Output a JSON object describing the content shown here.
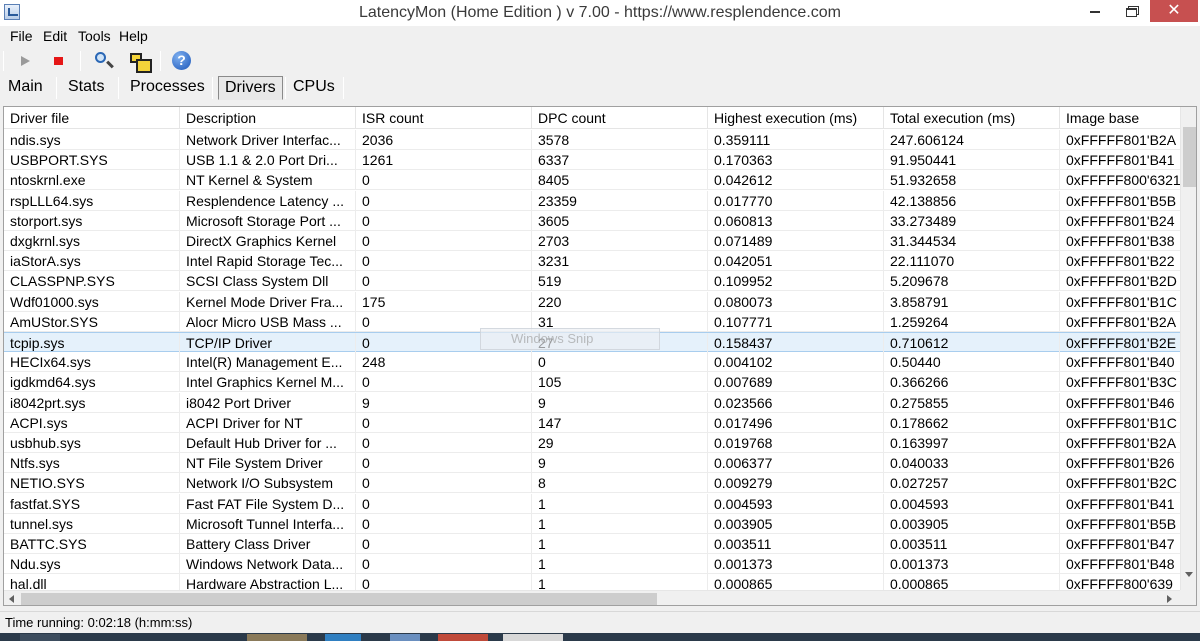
{
  "window": {
    "title": "LatencyMon  (Home Edition )  v 7.00 - https://www.resplendence.com",
    "min_label": "",
    "max_label": "",
    "close_label": "✕"
  },
  "menu": {
    "file": "File",
    "edit": "Edit",
    "tools": "Tools",
    "help": "Help"
  },
  "toolbar": {
    "icons": [
      "play-icon",
      "stop-icon",
      "search-icon",
      "windows-icon",
      "help-icon"
    ],
    "help_glyph": "?"
  },
  "tabs": [
    {
      "label": "Main"
    },
    {
      "label": "Stats"
    },
    {
      "label": "Processes"
    },
    {
      "label": "Drivers",
      "active": true
    },
    {
      "label": "CPUs"
    }
  ],
  "grid": {
    "columns": [
      "Driver file",
      "Description",
      "ISR count",
      "DPC count",
      "Highest execution (ms)",
      "Total execution (ms)",
      "Image base"
    ],
    "rows": [
      [
        "ndis.sys",
        "Network Driver Interfac...",
        "2036",
        "3578",
        "0.359111",
        "247.606124",
        "0xFFFFF801'B2A"
      ],
      [
        "USBPORT.SYS",
        "USB 1.1 & 2.0 Port Dri...",
        "1261",
        "6337",
        "0.170363",
        "91.950441",
        "0xFFFFF801'B41"
      ],
      [
        "ntoskrnl.exe",
        "NT Kernel & System",
        "0",
        "8405",
        "0.042612",
        "51.932658",
        "0xFFFFF800'6321"
      ],
      [
        "rspLLL64.sys",
        "Resplendence Latency ...",
        "0",
        "23359",
        "0.017770",
        "42.138856",
        "0xFFFFF801'B5B"
      ],
      [
        "storport.sys",
        "Microsoft Storage Port ...",
        "0",
        "3605",
        "0.060813",
        "33.273489",
        "0xFFFFF801'B24"
      ],
      [
        "dxgkrnl.sys",
        "DirectX Graphics Kernel",
        "0",
        "2703",
        "0.071489",
        "31.344534",
        "0xFFFFF801'B38"
      ],
      [
        "iaStorA.sys",
        "Intel Rapid Storage Tec...",
        "0",
        "3231",
        "0.042051",
        "22.111070",
        "0xFFFFF801'B22"
      ],
      [
        "CLASSPNP.SYS",
        "SCSI Class System Dll",
        "0",
        "519",
        "0.109952",
        "5.209678",
        "0xFFFFF801'B2D"
      ],
      [
        "Wdf01000.sys",
        "Kernel Mode Driver Fra...",
        "175",
        "220",
        "0.080073",
        "3.858791",
        "0xFFFFF801'B1C"
      ],
      [
        "AmUStor.SYS",
        "Alocr Micro USB Mass ...",
        "0",
        "31",
        "0.107771",
        "1.259264",
        "0xFFFFF801'B2A"
      ],
      [
        "tcpip.sys",
        "TCP/IP Driver",
        "0",
        "27",
        "0.158437",
        "0.710612",
        "0xFFFFF801'B2E"
      ],
      [
        "HECIx64.sys",
        "Intel(R) Management E...",
        "248",
        "0",
        "0.004102",
        "0.50440",
        "0xFFFFF801'B40"
      ],
      [
        "igdkmd64.sys",
        "Intel Graphics Kernel M...",
        "0",
        "105",
        "0.007689",
        "0.366266",
        "0xFFFFF801'B3C"
      ],
      [
        "i8042prt.sys",
        "i8042 Port Driver",
        "9",
        "9",
        "0.023566",
        "0.275855",
        "0xFFFFF801'B46"
      ],
      [
        "ACPI.sys",
        "ACPI Driver for NT",
        "0",
        "147",
        "0.017496",
        "0.178662",
        "0xFFFFF801'B1C"
      ],
      [
        "usbhub.sys",
        "Default Hub Driver for ...",
        "0",
        "29",
        "0.019768",
        "0.163997",
        "0xFFFFF801'B2A"
      ],
      [
        "Ntfs.sys",
        "NT File System Driver",
        "0",
        "9",
        "0.006377",
        "0.040033",
        "0xFFFFF801'B26"
      ],
      [
        "NETIO.SYS",
        "Network I/O Subsystem",
        "0",
        "8",
        "0.009279",
        "0.027257",
        "0xFFFFF801'B2C"
      ],
      [
        "fastfat.SYS",
        "Fast FAT File System D...",
        "0",
        "1",
        "0.004593",
        "0.004593",
        "0xFFFFF801'B41"
      ],
      [
        "tunnel.sys",
        "Microsoft Tunnel Interfa...",
        "0",
        "1",
        "0.003905",
        "0.003905",
        "0xFFFFF801'B5B"
      ],
      [
        "BATTC.SYS",
        "Battery Class Driver",
        "0",
        "1",
        "0.003511",
        "0.003511",
        "0xFFFFF801'B47"
      ],
      [
        "Ndu.sys",
        "Windows Network Data...",
        "0",
        "1",
        "0.001373",
        "0.001373",
        "0xFFFFF801'B48"
      ],
      [
        "hal.dll",
        "Hardware Abstraction L...",
        "0",
        "1",
        "0.000865",
        "0.000865",
        "0xFFFFF800'639"
      ]
    ],
    "selected_row": 10,
    "overlay_text": "Windows Snip"
  },
  "status": {
    "text": "Time running: 0:02:18  (h:mm:ss)"
  },
  "colors": {
    "close_button": "#c75050",
    "selected_row": "#e5f1fb",
    "stop_red": "#e51616",
    "help_blue": "#1a55b8"
  }
}
